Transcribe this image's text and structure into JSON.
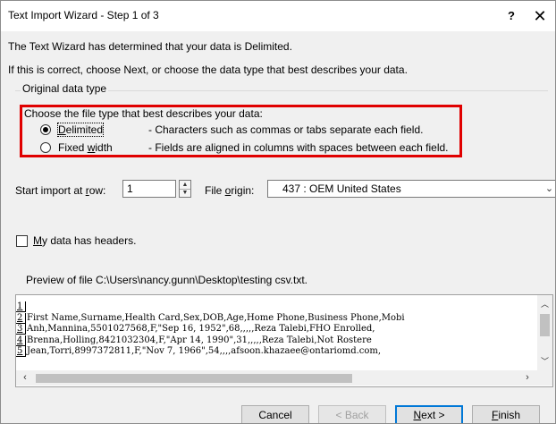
{
  "window": {
    "title": "Text Import Wizard - Step 1 of 3",
    "help_label": "?",
    "close_label": "✕"
  },
  "intro": {
    "line1": "The Text Wizard has determined that your data is Delimited.",
    "line2": "If this is correct, choose Next, or choose the data type that best describes your data."
  },
  "original_data_type": {
    "group_label": "Original data type",
    "choose_label": "Choose the file type that best describes your data:",
    "options": [
      {
        "label_pre": "",
        "label_accel": "D",
        "label_post": "elimited",
        "description": "- Characters such as commas or tabs separate each field.",
        "selected": true
      },
      {
        "label_pre": "Fixed ",
        "label_accel": "w",
        "label_post": "idth",
        "description": "- Fields are aligned in columns with spaces between each field.",
        "selected": false
      }
    ]
  },
  "start_import": {
    "label_pre": "Start import at ",
    "label_accel": "r",
    "label_post": "ow:",
    "value": "1"
  },
  "file_origin": {
    "label_pre": "File ",
    "label_accel": "o",
    "label_post": "rigin:",
    "value": "437 : OEM United States"
  },
  "headers_checkbox": {
    "label_accel": "M",
    "label_post": "y data has headers.",
    "checked": false
  },
  "preview": {
    "label": "Preview of file C:\\Users\\nancy.gunn\\Desktop\\testing csv.txt.",
    "rows": [
      {
        "num": "1",
        "text": ""
      },
      {
        "num": "2",
        "text": "First Name,Surname,Health Card,Sex,DOB,Age,Home Phone,Business Phone,Mobi"
      },
      {
        "num": "3",
        "text": "Anh,Mannina,5501027568,F,\"Sep 16, 1952\",68,,,,,Reza Talebi,FHO Enrolled,"
      },
      {
        "num": "4",
        "text": "Brenna,Holling,8421032304,F,\"Apr 14, 1990\",31,,,,,Reza Talebi,Not Rostere"
      },
      {
        "num": "5",
        "text": "Jean,Torri,8997372811,F,\"Nov 7, 1966\",54,,,,afsoon.khazaee@ontariomd.com,"
      }
    ]
  },
  "buttons": {
    "cancel": "Cancel",
    "back": "< Back",
    "next_accel": "N",
    "next_post": "ext >",
    "finish_accel": "F",
    "finish_post": "inish"
  }
}
